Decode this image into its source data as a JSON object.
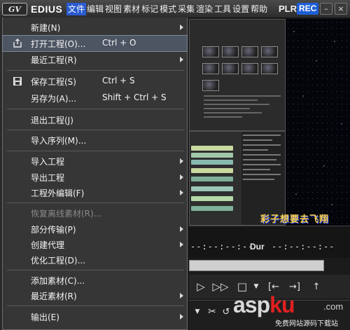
{
  "app": {
    "logo": "GV",
    "name": "EDIUS"
  },
  "menubar": [
    {
      "label": "文件",
      "active": true
    },
    {
      "label": "编辑"
    },
    {
      "label": "视图"
    },
    {
      "label": "素材"
    },
    {
      "label": "标记"
    },
    {
      "label": "模式"
    },
    {
      "label": "采集"
    },
    {
      "label": "渲染"
    },
    {
      "label": "工具"
    },
    {
      "label": "设置"
    },
    {
      "label": "帮助"
    }
  ],
  "mode": {
    "plr": "PLR",
    "rec": "REC"
  },
  "file_menu": {
    "items": [
      {
        "label": "新建(N)",
        "submenu": true
      },
      {
        "label": "打开工程(O)...",
        "shortcut": "Ctrl + O",
        "icon": "folder-open-icon",
        "highlighted": true
      },
      {
        "label": "最近工程(R)",
        "submenu": true
      },
      {
        "label": "保存工程(S)",
        "shortcut": "Ctrl + S",
        "icon": "floppy-disk-icon"
      },
      {
        "label": "另存为(A)...",
        "shortcut": "Shift + Ctrl + S"
      },
      {
        "label": "退出工程(J)"
      },
      {
        "label": "导入序列(M)..."
      },
      {
        "label": "导入工程",
        "submenu": true
      },
      {
        "label": "导出工程",
        "submenu": true
      },
      {
        "label": "工程外编辑(F)",
        "submenu": true
      },
      {
        "label": "恢复离线素材(R)...",
        "disabled": true
      },
      {
        "label": "部分传输(P)",
        "submenu": true
      },
      {
        "label": "创建代理",
        "submenu": true
      },
      {
        "label": "优化工程(D)..."
      },
      {
        "label": "添加素材(C)..."
      },
      {
        "label": "最近素材(R)",
        "submenu": true
      },
      {
        "label": "输出(E)",
        "submenu": true
      }
    ]
  },
  "player": {
    "in_timecode": "--:--:--:--",
    "dur_label": "Dur",
    "dur_timecode": "--:--:--:--"
  },
  "preview_caption": "彩子想要去飞翔",
  "watermark": {
    "logo_part1": "asp",
    "logo_part2": "ku",
    "tld": ".com",
    "subtitle": "免费网站源码下载站"
  }
}
